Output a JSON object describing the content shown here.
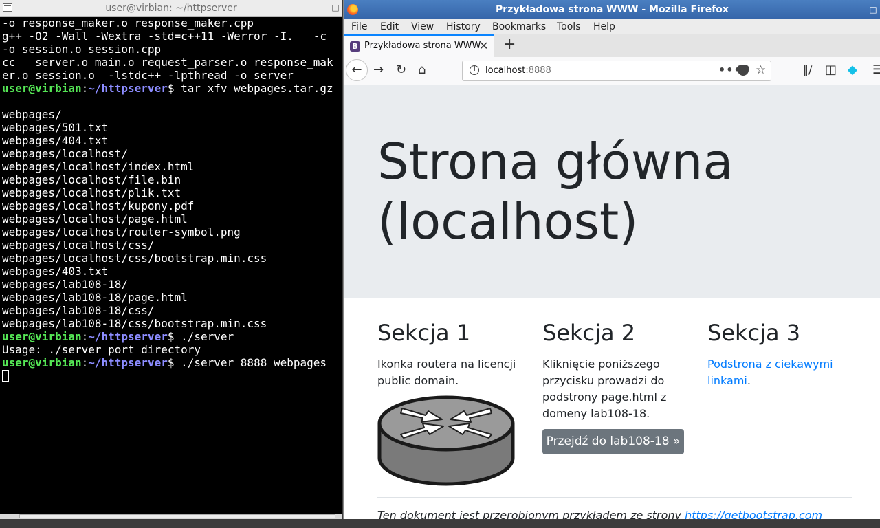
{
  "terminal": {
    "title": "user@virbian: ~/httpserver",
    "lines": [
      {
        "out": "-o response_maker.o response_maker.cpp"
      },
      {
        "out": "g++ -O2 -Wall -Wextra -std=c++11 -Werror -I.   -c"
      },
      {
        "out": "-o session.o session.cpp"
      },
      {
        "out": "cc   server.o main.o request_parser.o response_mak"
      },
      {
        "out": "er.o session.o  -lstdc++ -lpthread -o server"
      },
      {
        "user": "user@virbian",
        "path": "~/httpserver",
        "cmd": " tar xfv webpages.tar.gz"
      },
      {
        "out": ""
      },
      {
        "out": "webpages/"
      },
      {
        "out": "webpages/501.txt"
      },
      {
        "out": "webpages/404.txt"
      },
      {
        "out": "webpages/localhost/"
      },
      {
        "out": "webpages/localhost/index.html"
      },
      {
        "out": "webpages/localhost/file.bin"
      },
      {
        "out": "webpages/localhost/plik.txt"
      },
      {
        "out": "webpages/localhost/kupony.pdf"
      },
      {
        "out": "webpages/localhost/page.html"
      },
      {
        "out": "webpages/localhost/router-symbol.png"
      },
      {
        "out": "webpages/localhost/css/"
      },
      {
        "out": "webpages/localhost/css/bootstrap.min.css"
      },
      {
        "out": "webpages/403.txt"
      },
      {
        "out": "webpages/lab108-18/"
      },
      {
        "out": "webpages/lab108-18/page.html"
      },
      {
        "out": "webpages/lab108-18/css/"
      },
      {
        "out": "webpages/lab108-18/css/bootstrap.min.css"
      },
      {
        "user": "user@virbian",
        "path": "~/httpserver",
        "cmd": " ./server"
      },
      {
        "out": "Usage: ./server port directory"
      },
      {
        "user": "user@virbian",
        "path": "~/httpserver",
        "cmd": " ./server 8888 webpages"
      }
    ]
  },
  "firefox": {
    "title": "Przykładowa strona WWW - Mozilla Firefox",
    "menu": [
      "File",
      "Edit",
      "View",
      "History",
      "Bookmarks",
      "Tools",
      "Help"
    ],
    "tab": {
      "title": "Przykładowa strona WWW",
      "favicon": "B"
    },
    "url": {
      "host": "localhost",
      "port": ":8888"
    },
    "icons": {
      "back": "back-arrow-icon",
      "forward": "forward-arrow-icon",
      "reload": "reload-icon",
      "home": "home-icon"
    },
    "accent": "#0a84ff"
  },
  "page": {
    "heading": "Strona główna (localhost)",
    "sections": [
      {
        "title": "Sekcja 1",
        "text": "Ikonka routera na licencji public domain."
      },
      {
        "title": "Sekcja 2",
        "text": "Kliknięcie poniższego przycisku prowadzi do podstrony page.html z domeny lab108-18.",
        "button": "Przejdź do lab108-18 »"
      },
      {
        "title": "Sekcja 3",
        "link": "Podstrona z ciekawymi linkami",
        "after": "."
      }
    ],
    "footer": {
      "text": "Ten dokument jest przerobionym przykładem ze strony ",
      "link": "https://getbootstrap.com"
    }
  }
}
